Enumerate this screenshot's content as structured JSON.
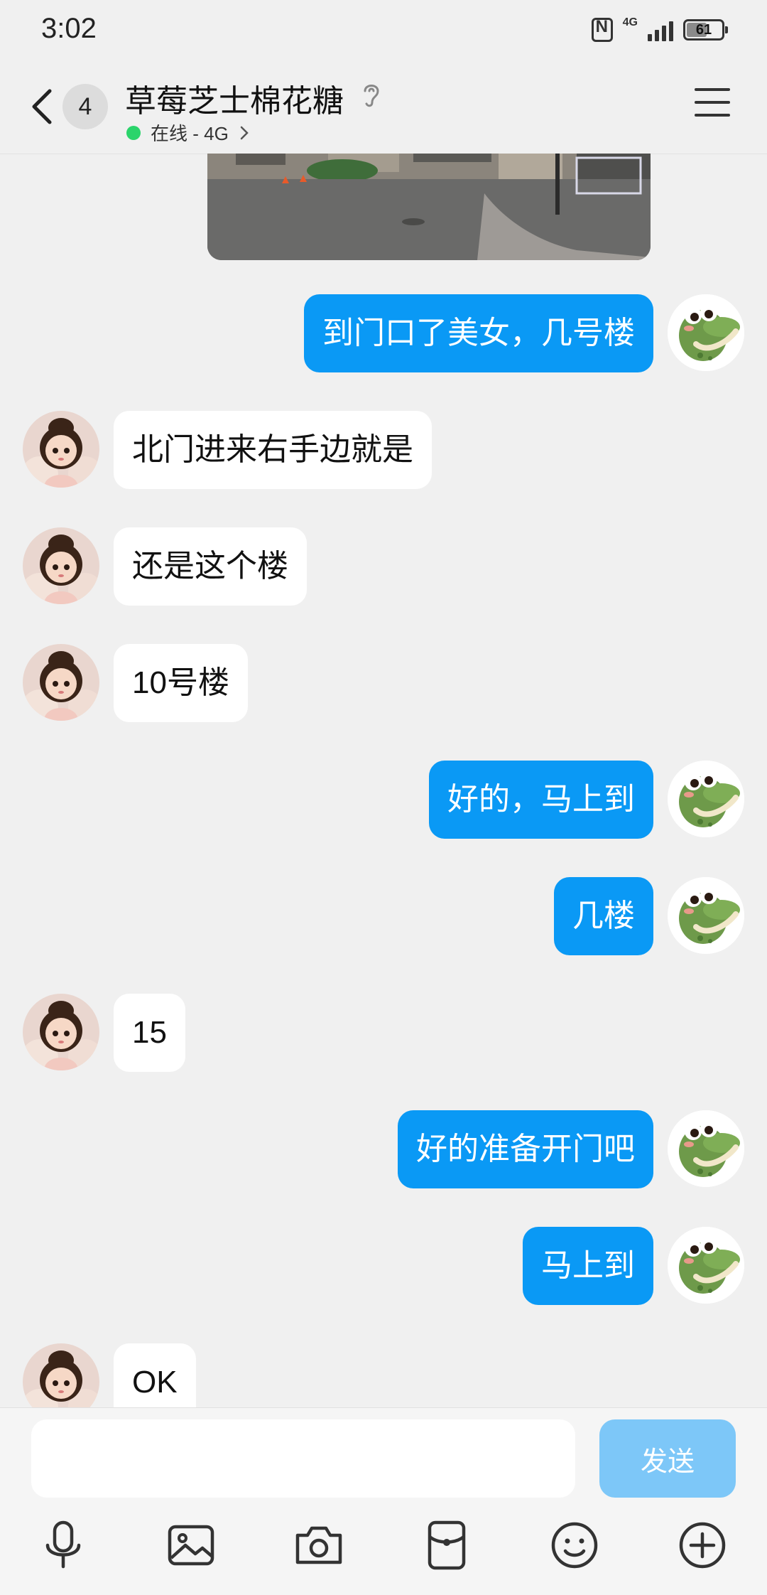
{
  "status_bar": {
    "time": "3:02",
    "network": "4G",
    "battery": "61",
    "battery_level": 0.61
  },
  "header": {
    "unread_count": "4",
    "contact_name": "草莓芝士棉花糖",
    "online_status": "在线 - 4G"
  },
  "messages": [
    {
      "side": "out",
      "text": "到门口了美女，几号楼"
    },
    {
      "side": "in",
      "text": "北门进来右手边就是"
    },
    {
      "side": "in",
      "text": "还是这个楼"
    },
    {
      "side": "in",
      "text": "10号楼"
    },
    {
      "side": "out",
      "text": "好的，马上到"
    },
    {
      "side": "out",
      "text": "几楼"
    },
    {
      "side": "in",
      "text": "15"
    },
    {
      "side": "out",
      "text": "好的准备开门吧"
    },
    {
      "side": "out",
      "text": "马上到"
    },
    {
      "side": "in",
      "text": "OK"
    }
  ],
  "composer": {
    "input_value": "",
    "send_label": "发送"
  },
  "toolbar_icons": [
    "microphone-icon",
    "image-icon",
    "camera-icon",
    "red-packet-icon",
    "emoji-icon",
    "plus-icon"
  ],
  "colors": {
    "outgoing_bubble": "#0a99f5",
    "incoming_bubble": "#ffffff",
    "send_button_disabled": "#7dc7f8",
    "online_dot": "#2bd46b",
    "background": "#f0f0f0"
  }
}
